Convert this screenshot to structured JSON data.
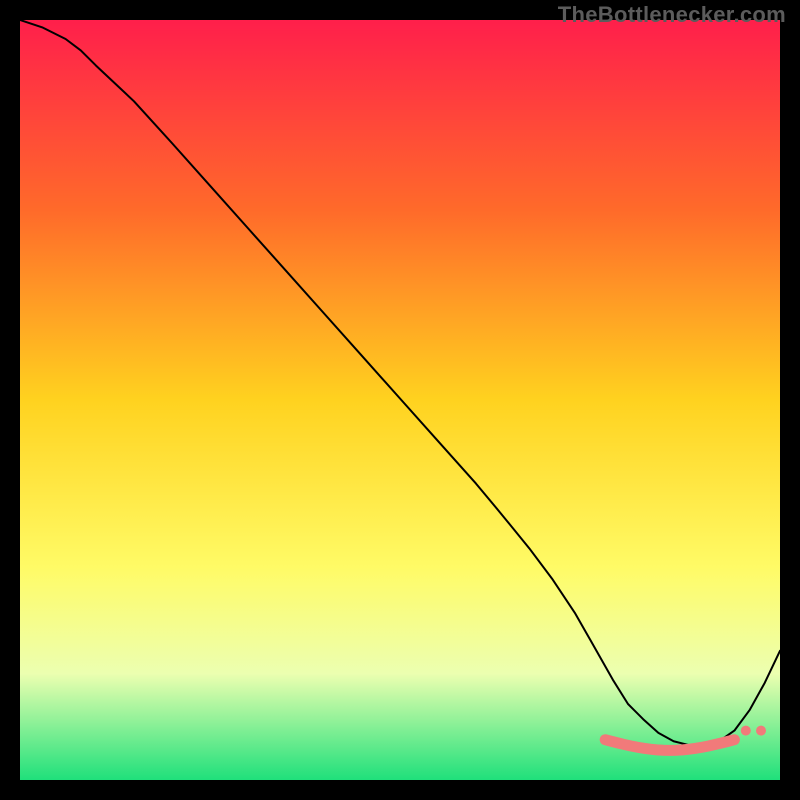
{
  "watermark": "TheBottlenecker.com",
  "chart_data": {
    "type": "line",
    "title": "",
    "xlabel": "",
    "ylabel": "",
    "xlim": [
      0,
      100
    ],
    "ylim": [
      0,
      100
    ],
    "background_gradient_stops": [
      {
        "offset": 0,
        "color": "#ff1f4b"
      },
      {
        "offset": 25,
        "color": "#ff6a2a"
      },
      {
        "offset": 50,
        "color": "#ffd21f"
      },
      {
        "offset": 72,
        "color": "#fffb66"
      },
      {
        "offset": 86,
        "color": "#ecffb0"
      },
      {
        "offset": 100,
        "color": "#1fe07b"
      }
    ],
    "series": [
      {
        "name": "bottleneck-curve",
        "color": "#000000",
        "stroke_width": 2,
        "x": [
          0,
          3,
          6,
          8,
          10,
          15,
          20,
          25,
          30,
          35,
          40,
          45,
          50,
          55,
          60,
          63,
          67,
          70,
          73,
          75,
          78,
          80,
          82,
          84,
          86,
          88,
          90,
          92,
          94,
          96,
          98,
          100
        ],
        "y": [
          100,
          99,
          97.5,
          96,
          94,
          89.3,
          83.8,
          78.2,
          72.6,
          67,
          61.4,
          55.8,
          50.2,
          44.6,
          39,
          35.4,
          30.5,
          26.5,
          22,
          18.5,
          13.2,
          10,
          8,
          6.2,
          5.1,
          4.6,
          4.6,
          5.1,
          6.5,
          9.2,
          12.8,
          17
        ]
      },
      {
        "name": "highlight-band",
        "color": "#f17a7a",
        "type": "marker-band",
        "x_start": 77,
        "x_end": 94,
        "y_level": 5.3
      }
    ]
  }
}
